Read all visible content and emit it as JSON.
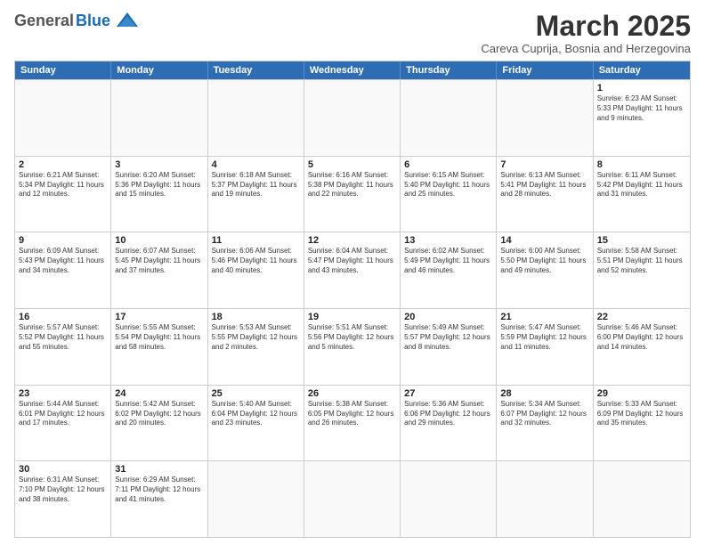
{
  "header": {
    "logo_general": "General",
    "logo_blue": "Blue",
    "month_title": "March 2025",
    "subtitle": "Careva Cuprija, Bosnia and Herzegovina"
  },
  "weekdays": [
    "Sunday",
    "Monday",
    "Tuesday",
    "Wednesday",
    "Thursday",
    "Friday",
    "Saturday"
  ],
  "rows": [
    [
      {
        "day": "",
        "info": ""
      },
      {
        "day": "",
        "info": ""
      },
      {
        "day": "",
        "info": ""
      },
      {
        "day": "",
        "info": ""
      },
      {
        "day": "",
        "info": ""
      },
      {
        "day": "",
        "info": ""
      },
      {
        "day": "1",
        "info": "Sunrise: 6:23 AM\nSunset: 5:33 PM\nDaylight: 11 hours\nand 9 minutes."
      }
    ],
    [
      {
        "day": "2",
        "info": "Sunrise: 6:21 AM\nSunset: 5:34 PM\nDaylight: 11 hours\nand 12 minutes."
      },
      {
        "day": "3",
        "info": "Sunrise: 6:20 AM\nSunset: 5:36 PM\nDaylight: 11 hours\nand 15 minutes."
      },
      {
        "day": "4",
        "info": "Sunrise: 6:18 AM\nSunset: 5:37 PM\nDaylight: 11 hours\nand 19 minutes."
      },
      {
        "day": "5",
        "info": "Sunrise: 6:16 AM\nSunset: 5:38 PM\nDaylight: 11 hours\nand 22 minutes."
      },
      {
        "day": "6",
        "info": "Sunrise: 6:15 AM\nSunset: 5:40 PM\nDaylight: 11 hours\nand 25 minutes."
      },
      {
        "day": "7",
        "info": "Sunrise: 6:13 AM\nSunset: 5:41 PM\nDaylight: 11 hours\nand 28 minutes."
      },
      {
        "day": "8",
        "info": "Sunrise: 6:11 AM\nSunset: 5:42 PM\nDaylight: 11 hours\nand 31 minutes."
      }
    ],
    [
      {
        "day": "9",
        "info": "Sunrise: 6:09 AM\nSunset: 5:43 PM\nDaylight: 11 hours\nand 34 minutes."
      },
      {
        "day": "10",
        "info": "Sunrise: 6:07 AM\nSunset: 5:45 PM\nDaylight: 11 hours\nand 37 minutes."
      },
      {
        "day": "11",
        "info": "Sunrise: 6:06 AM\nSunset: 5:46 PM\nDaylight: 11 hours\nand 40 minutes."
      },
      {
        "day": "12",
        "info": "Sunrise: 6:04 AM\nSunset: 5:47 PM\nDaylight: 11 hours\nand 43 minutes."
      },
      {
        "day": "13",
        "info": "Sunrise: 6:02 AM\nSunset: 5:49 PM\nDaylight: 11 hours\nand 46 minutes."
      },
      {
        "day": "14",
        "info": "Sunrise: 6:00 AM\nSunset: 5:50 PM\nDaylight: 11 hours\nand 49 minutes."
      },
      {
        "day": "15",
        "info": "Sunrise: 5:58 AM\nSunset: 5:51 PM\nDaylight: 11 hours\nand 52 minutes."
      }
    ],
    [
      {
        "day": "16",
        "info": "Sunrise: 5:57 AM\nSunset: 5:52 PM\nDaylight: 11 hours\nand 55 minutes."
      },
      {
        "day": "17",
        "info": "Sunrise: 5:55 AM\nSunset: 5:54 PM\nDaylight: 11 hours\nand 58 minutes."
      },
      {
        "day": "18",
        "info": "Sunrise: 5:53 AM\nSunset: 5:55 PM\nDaylight: 12 hours\nand 2 minutes."
      },
      {
        "day": "19",
        "info": "Sunrise: 5:51 AM\nSunset: 5:56 PM\nDaylight: 12 hours\nand 5 minutes."
      },
      {
        "day": "20",
        "info": "Sunrise: 5:49 AM\nSunset: 5:57 PM\nDaylight: 12 hours\nand 8 minutes."
      },
      {
        "day": "21",
        "info": "Sunrise: 5:47 AM\nSunset: 5:59 PM\nDaylight: 12 hours\nand 11 minutes."
      },
      {
        "day": "22",
        "info": "Sunrise: 5:46 AM\nSunset: 6:00 PM\nDaylight: 12 hours\nand 14 minutes."
      }
    ],
    [
      {
        "day": "23",
        "info": "Sunrise: 5:44 AM\nSunset: 6:01 PM\nDaylight: 12 hours\nand 17 minutes."
      },
      {
        "day": "24",
        "info": "Sunrise: 5:42 AM\nSunset: 6:02 PM\nDaylight: 12 hours\nand 20 minutes."
      },
      {
        "day": "25",
        "info": "Sunrise: 5:40 AM\nSunset: 6:04 PM\nDaylight: 12 hours\nand 23 minutes."
      },
      {
        "day": "26",
        "info": "Sunrise: 5:38 AM\nSunset: 6:05 PM\nDaylight: 12 hours\nand 26 minutes."
      },
      {
        "day": "27",
        "info": "Sunrise: 5:36 AM\nSunset: 6:06 PM\nDaylight: 12 hours\nand 29 minutes."
      },
      {
        "day": "28",
        "info": "Sunrise: 5:34 AM\nSunset: 6:07 PM\nDaylight: 12 hours\nand 32 minutes."
      },
      {
        "day": "29",
        "info": "Sunrise: 5:33 AM\nSunset: 6:09 PM\nDaylight: 12 hours\nand 35 minutes."
      }
    ],
    [
      {
        "day": "30",
        "info": "Sunrise: 6:31 AM\nSunset: 7:10 PM\nDaylight: 12 hours\nand 38 minutes."
      },
      {
        "day": "31",
        "info": "Sunrise: 6:29 AM\nSunset: 7:11 PM\nDaylight: 12 hours\nand 41 minutes."
      },
      {
        "day": "",
        "info": ""
      },
      {
        "day": "",
        "info": ""
      },
      {
        "day": "",
        "info": ""
      },
      {
        "day": "",
        "info": ""
      },
      {
        "day": "",
        "info": ""
      }
    ]
  ]
}
